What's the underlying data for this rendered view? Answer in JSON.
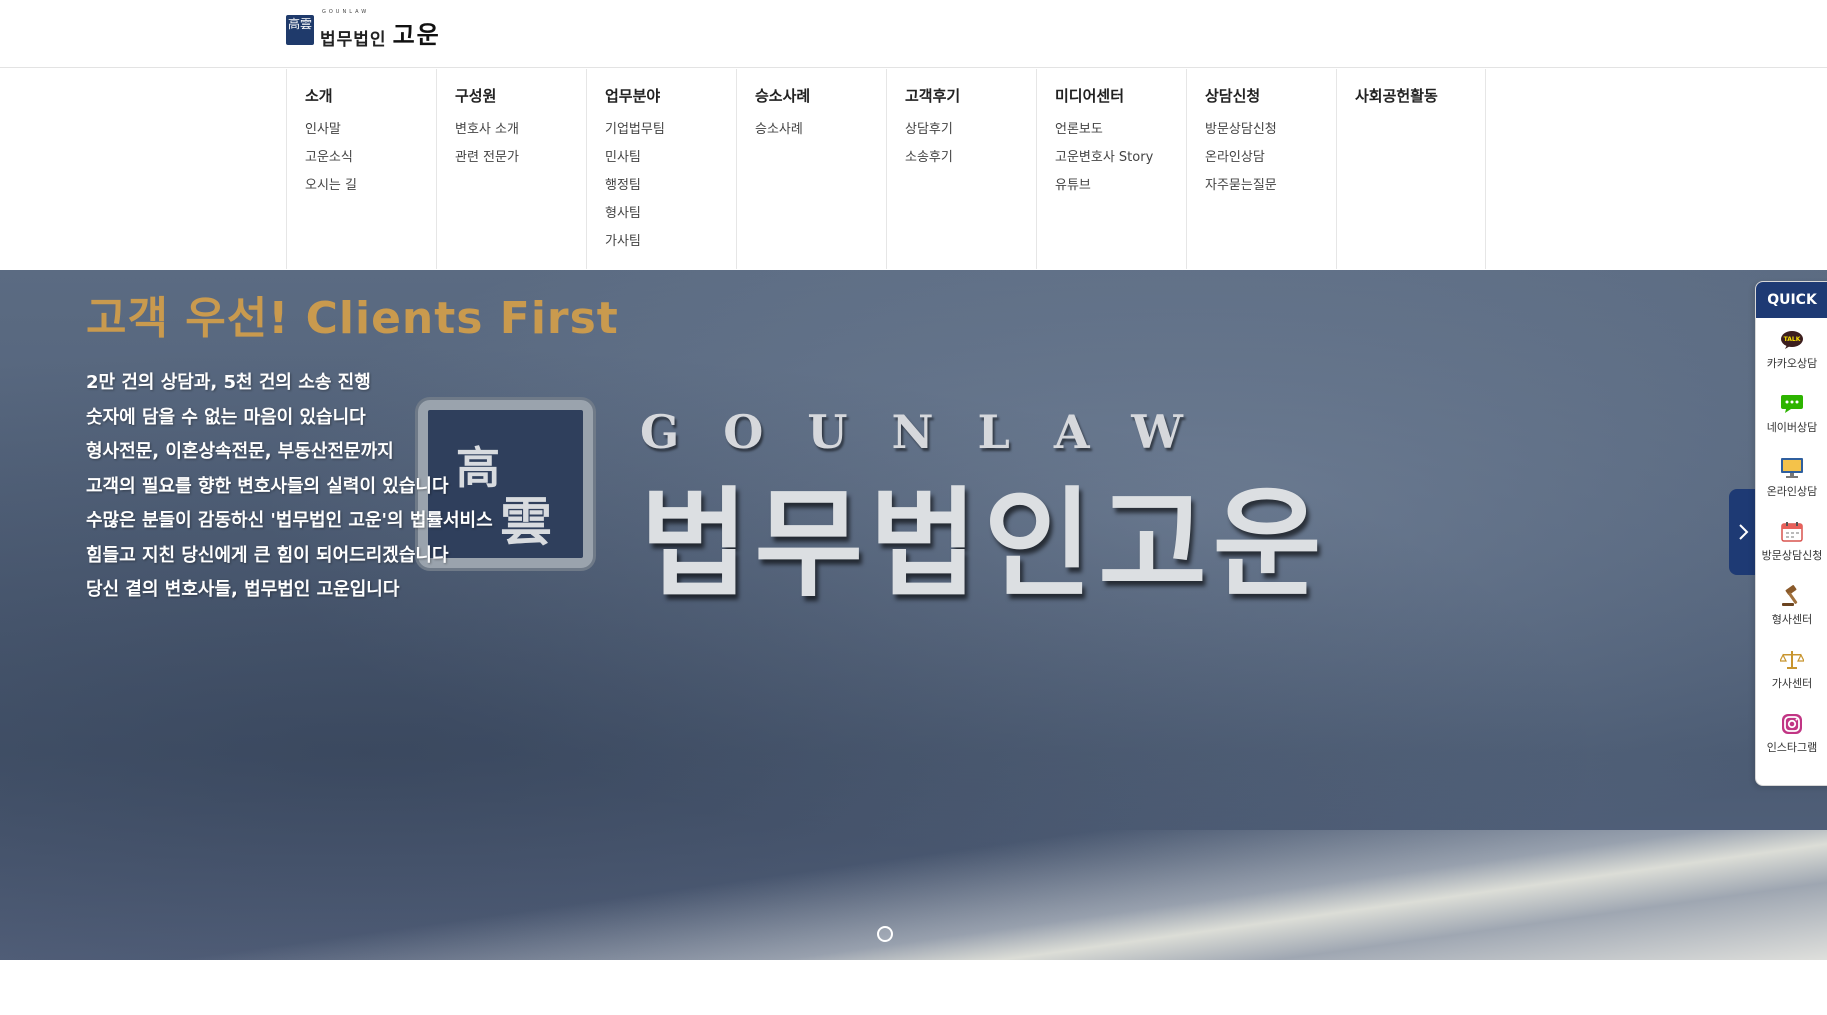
{
  "header": {
    "logo_en": "GOUNLAW",
    "logo_kr_small": "법무법인",
    "logo_kr_big": "고운",
    "logo_mark": "高雲"
  },
  "menu": [
    {
      "title": "소개",
      "items": [
        "인사말",
        "고운소식",
        "오시는 길"
      ]
    },
    {
      "title": "구성원",
      "items": [
        "변호사 소개",
        "관련 전문가"
      ]
    },
    {
      "title": "업무분야",
      "items": [
        "기업법무팀",
        "민사팀",
        "행정팀",
        "형사팀",
        "가사팀"
      ]
    },
    {
      "title": "승소사례",
      "items": [
        "승소사례"
      ]
    },
    {
      "title": "고객후기",
      "items": [
        "상담후기",
        "소송후기"
      ]
    },
    {
      "title": "미디어센터",
      "items": [
        "언론보도",
        "고운변호사 Story",
        "유튜브"
      ]
    },
    {
      "title": "상담신청",
      "items": [
        "방문상담신청",
        "온라인상담",
        "자주묻는질문"
      ]
    },
    {
      "title": "사회공헌활동",
      "items": []
    }
  ],
  "hero": {
    "heading": "고객 우선! Clients First",
    "lines": [
      "2만 건의 상담과, 5천 건의 소송 진행",
      "숫자에 담을 수 없는 마음이 있습니다",
      "형사전문, 이혼상속전문, 부동산전문까지",
      "고객의 필요를 향한 변호사들의 실력이 있습니다",
      "수많은 분들이 감동하신 '법무법인 고운'의 법률서비스",
      "힘들고 지친 당신에게 큰 힘이 되어드리겠습니다",
      "당신 곁의 변호사들, 법무법인 고운입니다"
    ],
    "plaque_en": "GOUNLAW",
    "plaque_kr": "법무법인고운",
    "plaque_seal": [
      "高",
      "雲"
    ]
  },
  "quick": {
    "title": "QUICK",
    "items": [
      {
        "label": "카카오상담",
        "icon": "kakao-talk-icon"
      },
      {
        "label": "네이버상담",
        "icon": "naver-talk-icon"
      },
      {
        "label": "온라인상담",
        "icon": "monitor-icon"
      },
      {
        "label": "방문상담신청",
        "icon": "calendar-icon"
      },
      {
        "label": "형사센터",
        "icon": "gavel-icon"
      },
      {
        "label": "가사센터",
        "icon": "scales-icon"
      },
      {
        "label": "인스타그램",
        "icon": "instagram-icon"
      }
    ]
  },
  "colors": {
    "brand_navy": "#1e3a74",
    "hero_gold": "#c99a4e",
    "kakao_yellow": "#3c1e1e",
    "naver_green": "#2db400"
  }
}
